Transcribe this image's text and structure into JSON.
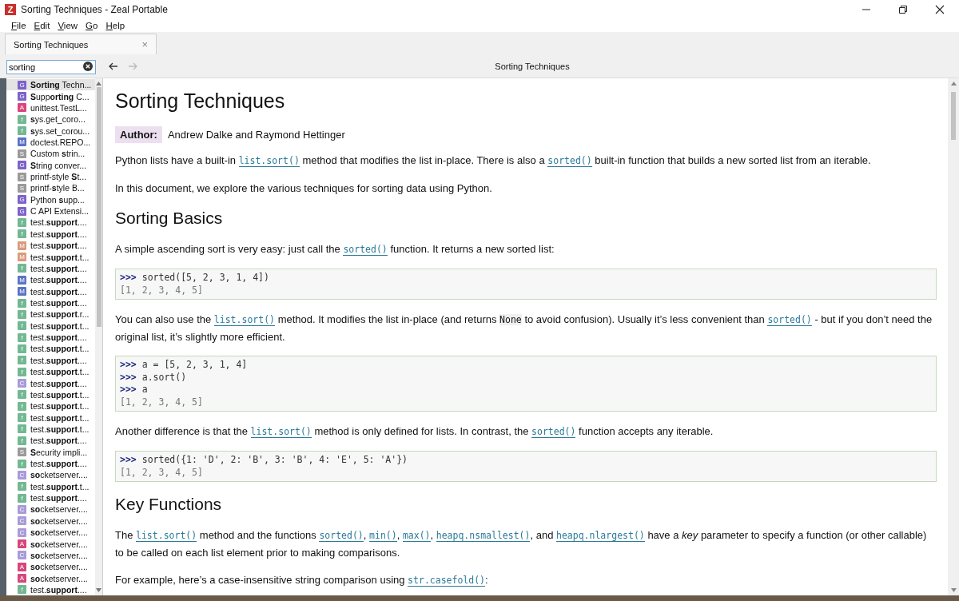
{
  "window": {
    "title": "Sorting Techniques - Zeal Portable",
    "app_icon": "Z"
  },
  "menu": [
    "File",
    "Edit",
    "View",
    "Go",
    "Help"
  ],
  "tabs": [
    {
      "label": "Sorting Techniques",
      "close": "×",
      "selected": true
    }
  ],
  "search": {
    "value": "sorting"
  },
  "toolbar": {
    "back_disabled": false,
    "forward_disabled": true,
    "page_title": "Sorting Techniques"
  },
  "results": [
    {
      "badge": "G",
      "kind": "guide",
      "label": "**Sorting** Techn...",
      "selected": true
    },
    {
      "badge": "G",
      "kind": "guide",
      "label": "**S**upp**orting** C...",
      "selected": false
    },
    {
      "badge": "A",
      "kind": "attribute",
      "label": "unittest.TestL...",
      "selected": false
    },
    {
      "badge": "f",
      "kind": "function",
      "label": "**s**ys.get_coro...",
      "selected": false
    },
    {
      "badge": "f",
      "kind": "function",
      "label": "**s**ys.set_corou...",
      "selected": false
    },
    {
      "badge": "M",
      "kind": "module",
      "label": "doctest.REPO...",
      "selected": false
    },
    {
      "badge": "S",
      "kind": "section",
      "label": "Custom **s**trin...",
      "selected": false
    },
    {
      "badge": "G",
      "kind": "guide",
      "label": "**S**tring conver...",
      "selected": false
    },
    {
      "badge": "S",
      "kind": "section",
      "label": "printf-style **S**t...",
      "selected": false
    },
    {
      "badge": "S",
      "kind": "section",
      "label": "printf-**s**tyle B...",
      "selected": false
    },
    {
      "badge": "G",
      "kind": "guide",
      "label": "Python **s**upp...",
      "selected": false
    },
    {
      "badge": "G",
      "kind": "guide",
      "label": "C API Extensi...",
      "selected": false
    },
    {
      "badge": "f",
      "kind": "function",
      "label": "test.**support**....",
      "selected": false
    },
    {
      "badge": "f",
      "kind": "function",
      "label": "test.**support**....",
      "selected": false
    },
    {
      "badge": "M",
      "kind": "method",
      "label": "test.**support**....",
      "selected": false
    },
    {
      "badge": "M",
      "kind": "method",
      "label": "test.**support**.t...",
      "selected": false
    },
    {
      "badge": "f",
      "kind": "function",
      "label": "test.**support**....",
      "selected": false
    },
    {
      "badge": "M",
      "kind": "module",
      "label": "test.**support**....",
      "selected": false
    },
    {
      "badge": "M",
      "kind": "module",
      "label": "test.**support**....",
      "selected": false
    },
    {
      "badge": "f",
      "kind": "function",
      "label": "test.**support**....",
      "selected": false
    },
    {
      "badge": "f",
      "kind": "function",
      "label": "test.**support**.r...",
      "selected": false
    },
    {
      "badge": "f",
      "kind": "function",
      "label": "test.**support**.t...",
      "selected": false
    },
    {
      "badge": "f",
      "kind": "function",
      "label": "test.**support**....",
      "selected": false
    },
    {
      "badge": "f",
      "kind": "function",
      "label": "test.**support**.t...",
      "selected": false
    },
    {
      "badge": "f",
      "kind": "function",
      "label": "test.**support**....",
      "selected": false
    },
    {
      "badge": "f",
      "kind": "function",
      "label": "test.**support**.t...",
      "selected": false
    },
    {
      "badge": "C",
      "kind": "class",
      "label": "test.**support**....",
      "selected": false
    },
    {
      "badge": "f",
      "kind": "function",
      "label": "test.**support**.t...",
      "selected": false
    },
    {
      "badge": "f",
      "kind": "function",
      "label": "test.**support**.t...",
      "selected": false
    },
    {
      "badge": "f",
      "kind": "function",
      "label": "test.**support**.t...",
      "selected": false
    },
    {
      "badge": "f",
      "kind": "function",
      "label": "test.**support**.t...",
      "selected": false
    },
    {
      "badge": "f",
      "kind": "function",
      "label": "test.**support**....",
      "selected": false
    },
    {
      "badge": "S",
      "kind": "section",
      "label": "**S**ecurity impli...",
      "selected": false
    },
    {
      "badge": "f",
      "kind": "function",
      "label": "test.**support**....",
      "selected": false
    },
    {
      "badge": "C",
      "kind": "class",
      "label": "**so**cketserver....",
      "selected": false
    },
    {
      "badge": "f",
      "kind": "function",
      "label": "test.**support**.t...",
      "selected": false
    },
    {
      "badge": "f",
      "kind": "function",
      "label": "test.**support**....",
      "selected": false
    },
    {
      "badge": "C",
      "kind": "class",
      "label": "**so**cketserver....",
      "selected": false
    },
    {
      "badge": "C",
      "kind": "class",
      "label": "**so**cketserver....",
      "selected": false
    },
    {
      "badge": "C",
      "kind": "class",
      "label": "**so**cketserver....",
      "selected": false
    },
    {
      "badge": "A",
      "kind": "attribute",
      "label": "**so**cketserver....",
      "selected": false
    },
    {
      "badge": "C",
      "kind": "class",
      "label": "**so**cketserver....",
      "selected": false
    },
    {
      "badge": "A",
      "kind": "attribute",
      "label": "**so**cketserver....",
      "selected": false
    },
    {
      "badge": "A",
      "kind": "attribute",
      "label": "**so**cketserver....",
      "selected": false
    },
    {
      "badge": "f",
      "kind": "function",
      "label": "test.**support**....",
      "selected": false
    }
  ],
  "document": [
    {
      "kind": "h1",
      "text": "Sorting Techniques"
    },
    {
      "kind": "field",
      "label": "Author:",
      "value": "Andrew Dalke and Raymond Hettinger"
    },
    {
      "kind": "p",
      "segments": [
        {
          "kind": "text",
          "text": "Python lists have a built-in "
        },
        {
          "kind": "link",
          "text": "list.sort()"
        },
        {
          "kind": "text",
          "text": " method that modifies the list in-place. There is also a "
        },
        {
          "kind": "link",
          "text": "sorted()"
        },
        {
          "kind": "text",
          "text": " built-in function that builds a new sorted list from an iterable."
        }
      ]
    },
    {
      "kind": "p",
      "segments": [
        {
          "kind": "text",
          "text": "In this document, we explore the various techniques for sorting data using Python."
        }
      ]
    },
    {
      "kind": "h2",
      "text": "Sorting Basics"
    },
    {
      "kind": "p",
      "segments": [
        {
          "kind": "text",
          "text": "A simple ascending sort is very easy: just call the "
        },
        {
          "kind": "link",
          "text": "sorted()"
        },
        {
          "kind": "text",
          "text": " function. It returns a new sorted list:"
        }
      ]
    },
    {
      "kind": "code",
      "lines": [
        {
          "kind": "input",
          "prompt": ">>>",
          "code": "sorted([5, 2, 3, 1, 4])"
        },
        {
          "kind": "output",
          "code": "[1, 2, 3, 4, 5]"
        }
      ]
    },
    {
      "kind": "p",
      "segments": [
        {
          "kind": "text",
          "text": "You can also use the "
        },
        {
          "kind": "link",
          "text": "list.sort()"
        },
        {
          "kind": "text",
          "text": " method. It modifies the list in-place (and returns "
        },
        {
          "kind": "code",
          "text": "None"
        },
        {
          "kind": "text",
          "text": " to avoid confusion). Usually it’s less convenient than "
        },
        {
          "kind": "link",
          "text": "sorted()"
        },
        {
          "kind": "text",
          "text": " - but if you don’t need the original list, it’s slightly more efficient."
        }
      ]
    },
    {
      "kind": "code",
      "lines": [
        {
          "kind": "input",
          "prompt": ">>>",
          "code": "a = [5, 2, 3, 1, 4]"
        },
        {
          "kind": "input",
          "prompt": ">>>",
          "code": "a.sort()"
        },
        {
          "kind": "input",
          "prompt": ">>>",
          "code": "a"
        },
        {
          "kind": "output",
          "code": "[1, 2, 3, 4, 5]"
        }
      ]
    },
    {
      "kind": "p",
      "segments": [
        {
          "kind": "text",
          "text": "Another difference is that the "
        },
        {
          "kind": "link",
          "text": "list.sort()"
        },
        {
          "kind": "text",
          "text": " method is only defined for lists. In contrast, the "
        },
        {
          "kind": "link",
          "text": "sorted()"
        },
        {
          "kind": "text",
          "text": " function accepts any iterable."
        }
      ]
    },
    {
      "kind": "code",
      "lines": [
        {
          "kind": "input",
          "prompt": ">>>",
          "code": "sorted({1: 'D', 2: 'B', 3: 'B', 4: 'E', 5: 'A'})"
        },
        {
          "kind": "output",
          "code": "[1, 2, 3, 4, 5]"
        }
      ]
    },
    {
      "kind": "h2",
      "text": "Key Functions"
    },
    {
      "kind": "p",
      "segments": [
        {
          "kind": "text",
          "text": "The "
        },
        {
          "kind": "link",
          "text": "list.sort()"
        },
        {
          "kind": "text",
          "text": " method and the functions "
        },
        {
          "kind": "link",
          "text": "sorted()"
        },
        {
          "kind": "text",
          "text": ", "
        },
        {
          "kind": "link",
          "text": "min()"
        },
        {
          "kind": "text",
          "text": ", "
        },
        {
          "kind": "link",
          "text": "max()"
        },
        {
          "kind": "text",
          "text": ", "
        },
        {
          "kind": "link",
          "text": "heapq.nsmallest()"
        },
        {
          "kind": "text",
          "text": ", and "
        },
        {
          "kind": "link",
          "text": "heapq.nlargest()"
        },
        {
          "kind": "text",
          "text": " have a *key* parameter to specify a function (or other callable) to be called on each list element prior to making comparisons."
        }
      ]
    },
    {
      "kind": "p",
      "segments": [
        {
          "kind": "text",
          "text": "For example, here’s a case-insensitive string comparison using "
        },
        {
          "kind": "link",
          "text": "str.casefold()"
        },
        {
          "kind": "text",
          "text": ":"
        }
      ]
    }
  ]
}
